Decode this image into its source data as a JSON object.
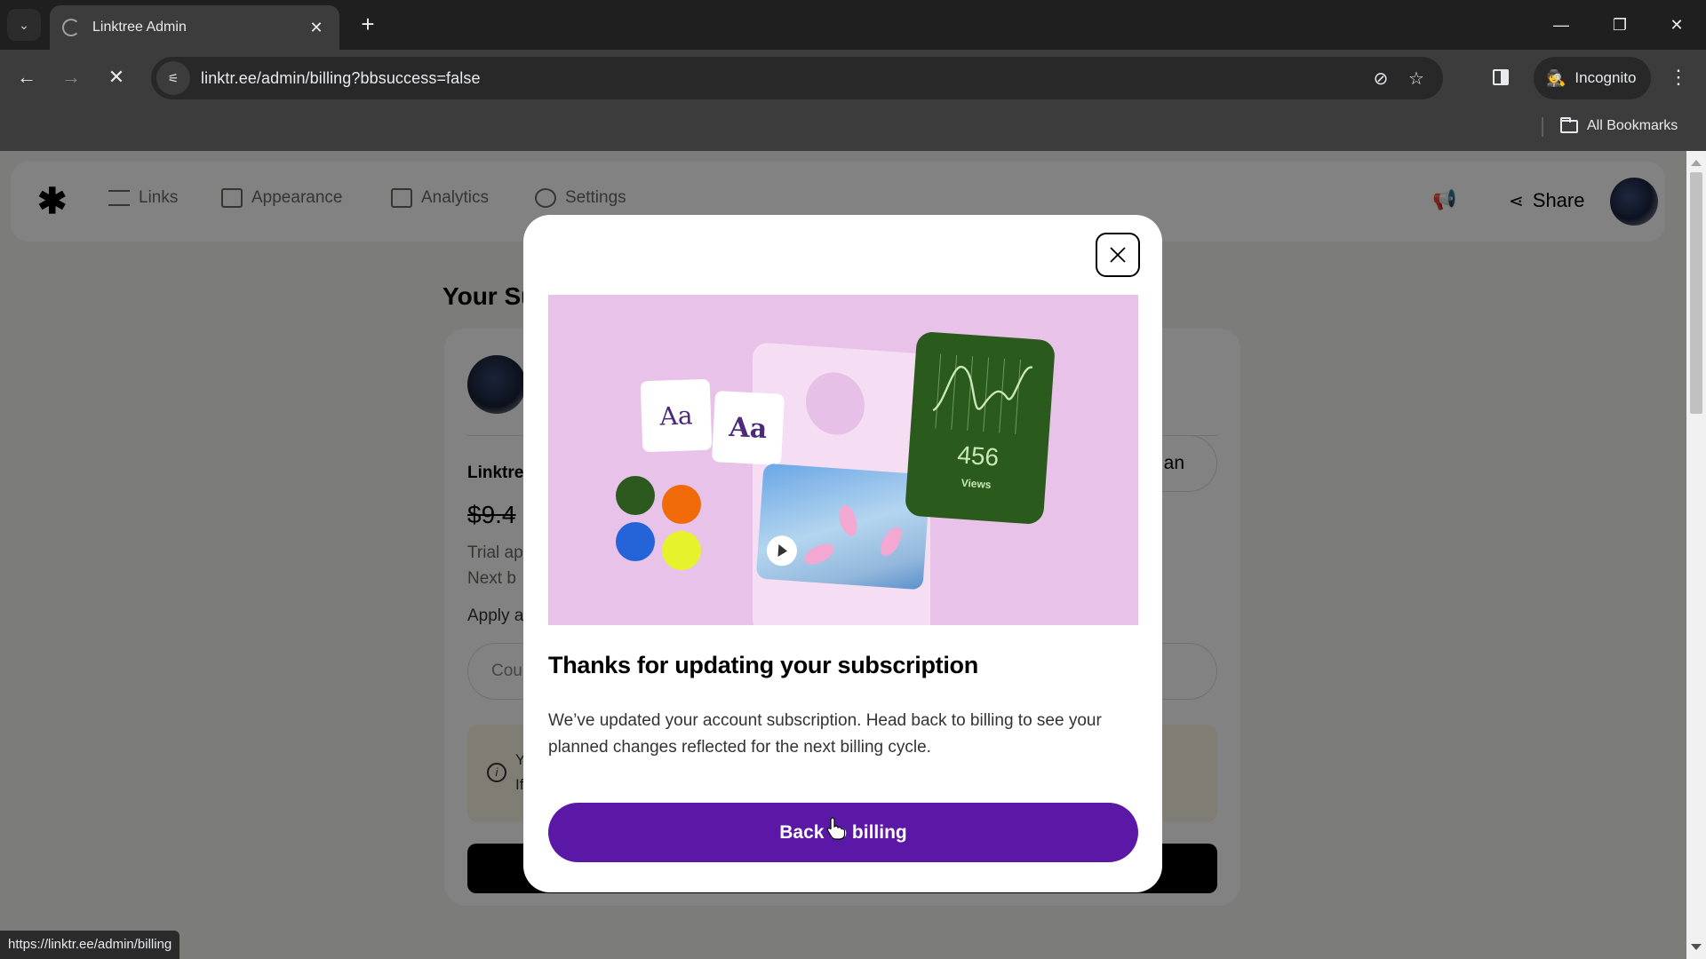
{
  "browser": {
    "tab_title": "Linktree Admin",
    "url": "linktr.ee/admin/billing?bbsuccess=false",
    "incognito_label": "Incognito",
    "all_bookmarks_label": "All Bookmarks",
    "status_url": "https://linktr.ee/admin/billing",
    "icons": {
      "tab_search": "chevron-down-icon",
      "tab_close": "close-icon",
      "new_tab": "plus-icon",
      "back": "arrow-left-icon",
      "forward": "arrow-right-icon",
      "stop": "close-icon",
      "site_info": "tune-icon",
      "tracking": "eye-off-icon",
      "bookmark": "star-icon",
      "side_panel": "side-panel-icon",
      "incognito": "incognito-icon",
      "menu": "kebab-menu-icon",
      "folder": "folder-icon"
    },
    "glyphs": {
      "tab_search": "⌄",
      "close": "✕",
      "plus": "+",
      "back": "←",
      "forward": "→",
      "minimize": "—",
      "restore": "❐",
      "site_info": "⚟",
      "eye_off": "⊘",
      "star": "☆",
      "incognito": "🕵",
      "menu": "⋮"
    }
  },
  "app_nav": {
    "logo_glyph": "✱",
    "items": [
      {
        "label": "Links",
        "icon": "links-icon"
      },
      {
        "label": "Appearance",
        "icon": "appearance-icon"
      },
      {
        "label": "Analytics",
        "icon": "analytics-icon"
      },
      {
        "label": "Settings",
        "icon": "settings-icon"
      }
    ],
    "megaphone_glyph": "📢",
    "share_label": "Share",
    "share_glyph": "⋖"
  },
  "page": {
    "title_partial": "Your Su",
    "plan_name_partial": "Linktre",
    "old_price_partial": "$9.4",
    "trial_partial": "Trial ap",
    "next_billing_partial": "Next b",
    "apply_partial": "Apply a",
    "coupon_placeholder_partial": "Cou",
    "change_plan_partial": "an",
    "notice_line1_partial": "Y",
    "notice_line2_partial": "If",
    "notice_icon_glyph": "i"
  },
  "modal": {
    "title": "Thanks for updating your subscription",
    "body": "We’ve updated your account subscription. Head back to billing to see your planned changes reflected for the next billing cycle.",
    "cta_label": "Back to billing",
    "illustration": {
      "font_sample_1": "Aa",
      "font_sample_2": "Aa",
      "stats_value": "456",
      "stats_label": "Views",
      "swatch_colors": [
        "#2c5a1e",
        "#f06a0a",
        "#2563d8",
        "#e6f22c"
      ]
    }
  },
  "colors": {
    "cta_purple": "#5b18a6",
    "hero_pink": "#e8c2e8",
    "stats_green": "#2a5a1c"
  }
}
